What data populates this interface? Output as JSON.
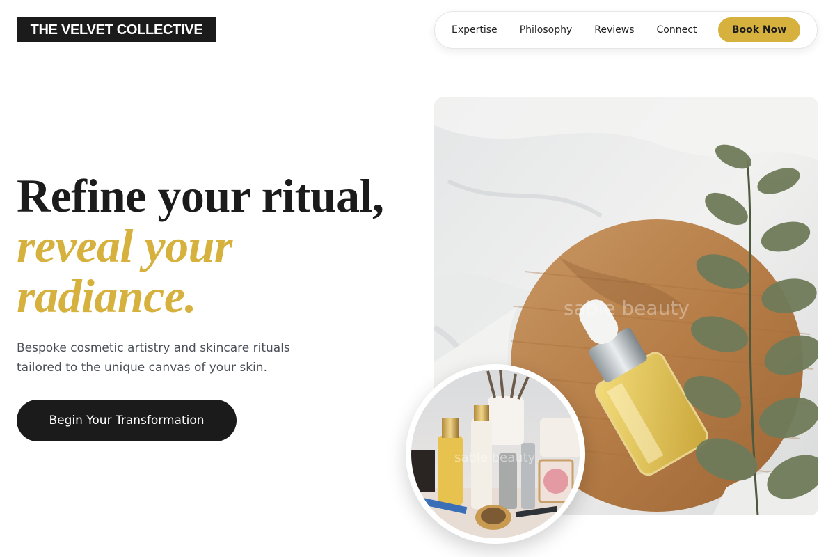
{
  "brand": {
    "name": "THE VELVET COLLECTIVE"
  },
  "nav": {
    "links": [
      "Expertise",
      "Philosophy",
      "Reviews",
      "Connect"
    ],
    "book_label": "Book Now"
  },
  "hero": {
    "title_line1": "Refine your ritual,",
    "title_accent_line1": "reveal your",
    "title_accent_line2": "radiance.",
    "subtitle": "Bespoke cosmetic artistry and skincare rituals tailored to the unique canvas of your skin.",
    "cta_label": "Begin Your Transformation"
  },
  "images": {
    "main_watermark": "sable beauty",
    "circle_watermark": "sable beauty"
  },
  "colors": {
    "accent": "#d6b13d",
    "dark": "#1b1b1b",
    "body_text": "#4a4f57"
  }
}
